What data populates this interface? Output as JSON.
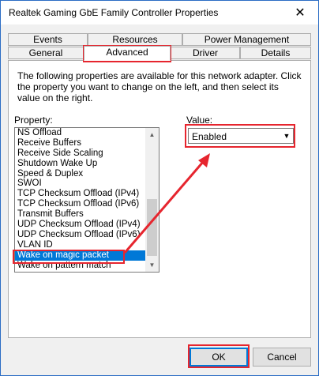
{
  "window": {
    "title": "Realtek Gaming GbE Family Controller Properties",
    "close_glyph": "✕"
  },
  "tabs": {
    "top_row": [
      "Events",
      "Resources",
      "Power Management"
    ],
    "bottom_row": [
      "General",
      "Advanced",
      "Driver",
      "Details"
    ],
    "active": "Advanced"
  },
  "description": "The following properties are available for this network adapter. Click the property you want to change on the left, and then select its value on the right.",
  "property": {
    "label": "Property:",
    "items": [
      "NS Offload",
      "Receive Buffers",
      "Receive Side Scaling",
      "Shutdown Wake Up",
      "Speed & Duplex",
      "SWOI",
      "TCP Checksum Offload (IPv4)",
      "TCP Checksum Offload (IPv6)",
      "Transmit Buffers",
      "UDP Checksum Offload (IPv4)",
      "UDP Checksum Offload (IPv6)",
      "VLAN ID",
      "Wake on magic packet",
      "Wake on pattern match"
    ],
    "selected": "Wake on magic packet"
  },
  "value": {
    "label": "Value:",
    "selected": "Enabled"
  },
  "buttons": {
    "ok": "OK",
    "cancel": "Cancel"
  },
  "annotation_color": "#e6252e",
  "selection_color": "#0078d7"
}
